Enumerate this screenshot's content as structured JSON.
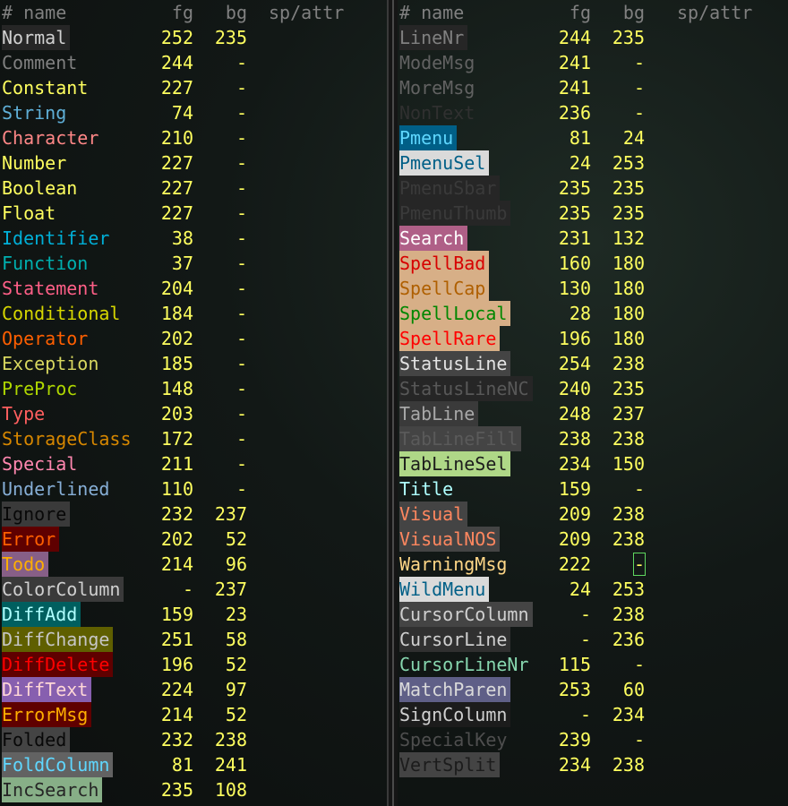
{
  "header": {
    "name": "# name",
    "fg": "fg",
    "bg": "bg",
    "sp": "sp/attr"
  },
  "left_rows": [
    {
      "name": "Normal",
      "fg": "252",
      "bg": "235",
      "color": "#d0d0d0",
      "bgc": "#262626"
    },
    {
      "name": "Comment",
      "fg": "244",
      "bg": "-",
      "color": "#808080",
      "bgc": ""
    },
    {
      "name": "Constant",
      "fg": "227",
      "bg": "-",
      "color": "#ffff5f",
      "bgc": ""
    },
    {
      "name": "String",
      "fg": "74",
      "bg": "-",
      "color": "#5fafd7",
      "bgc": ""
    },
    {
      "name": "Character",
      "fg": "210",
      "bg": "-",
      "color": "#ff8787",
      "bgc": ""
    },
    {
      "name": "Number",
      "fg": "227",
      "bg": "-",
      "color": "#ffff5f",
      "bgc": ""
    },
    {
      "name": "Boolean",
      "fg": "227",
      "bg": "-",
      "color": "#ffff5f",
      "bgc": ""
    },
    {
      "name": "Float",
      "fg": "227",
      "bg": "-",
      "color": "#ffff5f",
      "bgc": ""
    },
    {
      "name": "Identifier",
      "fg": "38",
      "bg": "-",
      "color": "#00afd7",
      "bgc": ""
    },
    {
      "name": "Function",
      "fg": "37",
      "bg": "-",
      "color": "#00afaf",
      "bgc": ""
    },
    {
      "name": "Statement",
      "fg": "204",
      "bg": "-",
      "color": "#ff5f87",
      "bgc": ""
    },
    {
      "name": "Conditional",
      "fg": "184",
      "bg": "-",
      "color": "#d7d700",
      "bgc": ""
    },
    {
      "name": "Operator",
      "fg": "202",
      "bg": "-",
      "color": "#ff5f00",
      "bgc": ""
    },
    {
      "name": "Exception",
      "fg": "185",
      "bg": "-",
      "color": "#d7d75f",
      "bgc": ""
    },
    {
      "name": "PreProc",
      "fg": "148",
      "bg": "-",
      "color": "#afd700",
      "bgc": ""
    },
    {
      "name": "Type",
      "fg": "203",
      "bg": "-",
      "color": "#ff5f5f",
      "bgc": ""
    },
    {
      "name": "StorageClass",
      "fg": "172",
      "bg": "-",
      "color": "#d78700",
      "bgc": ""
    },
    {
      "name": "Special",
      "fg": "211",
      "bg": "-",
      "color": "#ff87af",
      "bgc": ""
    },
    {
      "name": "Underlined",
      "fg": "110",
      "bg": "-",
      "color": "#87afd7",
      "bgc": ""
    },
    {
      "name": "Ignore",
      "fg": "232",
      "bg": "237",
      "color": "#080808",
      "bgc": "#3a3a3a"
    },
    {
      "name": "Error",
      "fg": "202",
      "bg": "52",
      "color": "#ff5f00",
      "bgc": "#5f0000"
    },
    {
      "name": "Todo",
      "fg": "214",
      "bg": "96",
      "color": "#ffaf00",
      "bgc": "#875f87"
    },
    {
      "name": "ColorColumn",
      "fg": "-",
      "bg": "237",
      "color": "#d0d0d0",
      "bgc": "#3a3a3a"
    },
    {
      "name": "DiffAdd",
      "fg": "159",
      "bg": "23",
      "color": "#afffff",
      "bgc": "#005f5f"
    },
    {
      "name": "DiffChange",
      "fg": "251",
      "bg": "58",
      "color": "#c6c6c6",
      "bgc": "#5f5f00"
    },
    {
      "name": "DiffDelete",
      "fg": "196",
      "bg": "52",
      "color": "#ff0000",
      "bgc": "#5f0000"
    },
    {
      "name": "DiffText",
      "fg": "224",
      "bg": "97",
      "color": "#ffd7d7",
      "bgc": "#875faf"
    },
    {
      "name": "ErrorMsg",
      "fg": "214",
      "bg": "52",
      "color": "#ffaf00",
      "bgc": "#5f0000"
    },
    {
      "name": "Folded",
      "fg": "232",
      "bg": "238",
      "color": "#080808",
      "bgc": "#444444"
    },
    {
      "name": "FoldColumn",
      "fg": "81",
      "bg": "241",
      "color": "#5fd7ff",
      "bgc": "#626262"
    },
    {
      "name": "IncSearch",
      "fg": "235",
      "bg": "108",
      "color": "#262626",
      "bgc": "#87af87"
    }
  ],
  "right_rows": [
    {
      "name": "LineNr",
      "fg": "244",
      "bg": "235",
      "color": "#808080",
      "bgc": "#262626"
    },
    {
      "name": "ModeMsg",
      "fg": "241",
      "bg": "-",
      "color": "#626262",
      "bgc": ""
    },
    {
      "name": "MoreMsg",
      "fg": "241",
      "bg": "-",
      "color": "#626262",
      "bgc": ""
    },
    {
      "name": "NonText",
      "fg": "236",
      "bg": "-",
      "color": "#303030",
      "bgc": ""
    },
    {
      "name": "Pmenu",
      "fg": "81",
      "bg": "24",
      "color": "#5fd7ff",
      "bgc": "#005f87"
    },
    {
      "name": "PmenuSel",
      "fg": "24",
      "bg": "253",
      "color": "#005f87",
      "bgc": "#dadada"
    },
    {
      "name": "PmenuSbar",
      "fg": "235",
      "bg": "235",
      "color": "#3a3a3a",
      "bgc": "#262626"
    },
    {
      "name": "PmenuThumb",
      "fg": "235",
      "bg": "235",
      "color": "#3a3a3a",
      "bgc": "#262626"
    },
    {
      "name": "Search",
      "fg": "231",
      "bg": "132",
      "color": "#ffffff",
      "bgc": "#af5f87"
    },
    {
      "name": "SpellBad",
      "fg": "160",
      "bg": "180",
      "color": "#d70000",
      "bgc": "#d7af87"
    },
    {
      "name": "SpellCap",
      "fg": "130",
      "bg": "180",
      "color": "#af5f00",
      "bgc": "#d7af87"
    },
    {
      "name": "SpellLocal",
      "fg": "28",
      "bg": "180",
      "color": "#008700",
      "bgc": "#d7af87"
    },
    {
      "name": "SpellRare",
      "fg": "196",
      "bg": "180",
      "color": "#ff0000",
      "bgc": "#d7af87"
    },
    {
      "name": "StatusLine",
      "fg": "254",
      "bg": "238",
      "color": "#e4e4e4",
      "bgc": "#444444"
    },
    {
      "name": "StatusLineNC",
      "fg": "240",
      "bg": "235",
      "color": "#585858",
      "bgc": "#262626"
    },
    {
      "name": "TabLine",
      "fg": "248",
      "bg": "237",
      "color": "#a8a8a8",
      "bgc": "#3a3a3a"
    },
    {
      "name": "TabLineFill",
      "fg": "238",
      "bg": "238",
      "color": "#5a5a5a",
      "bgc": "#444444"
    },
    {
      "name": "TabLineSel",
      "fg": "234",
      "bg": "150",
      "color": "#1c1c1c",
      "bgc": "#afd787"
    },
    {
      "name": "Title",
      "fg": "159",
      "bg": "-",
      "color": "#afffff",
      "bgc": ""
    },
    {
      "name": "Visual",
      "fg": "209",
      "bg": "238",
      "color": "#ff875f",
      "bgc": "#444444"
    },
    {
      "name": "VisualNOS",
      "fg": "209",
      "bg": "238",
      "color": "#ff875f",
      "bgc": "#444444"
    },
    {
      "name": "WarningMsg",
      "fg": "222",
      "bg": "-",
      "color": "#ffd787",
      "bgc": "",
      "boxed": true
    },
    {
      "name": "WildMenu",
      "fg": "24",
      "bg": "253",
      "color": "#005f87",
      "bgc": "#dadada"
    },
    {
      "name": "CursorColumn",
      "fg": "-",
      "bg": "238",
      "color": "#d0d0d0",
      "bgc": "#444444"
    },
    {
      "name": "CursorLine",
      "fg": "-",
      "bg": "236",
      "color": "#d0d0d0",
      "bgc": "#303030"
    },
    {
      "name": "CursorLineNr",
      "fg": "115",
      "bg": "-",
      "color": "#87d7af",
      "bgc": ""
    },
    {
      "name": "MatchParen",
      "fg": "253",
      "bg": "60",
      "color": "#dadada",
      "bgc": "#5f5f87"
    },
    {
      "name": "SignColumn",
      "fg": "-",
      "bg": "234",
      "color": "#d0d0d0",
      "bgc": "#1c1c1c"
    },
    {
      "name": "SpecialKey",
      "fg": "239",
      "bg": "-",
      "color": "#4e4e4e",
      "bgc": ""
    },
    {
      "name": "VertSplit",
      "fg": "234",
      "bg": "238",
      "color": "#1c1c1c",
      "bgc": "#444444"
    }
  ]
}
